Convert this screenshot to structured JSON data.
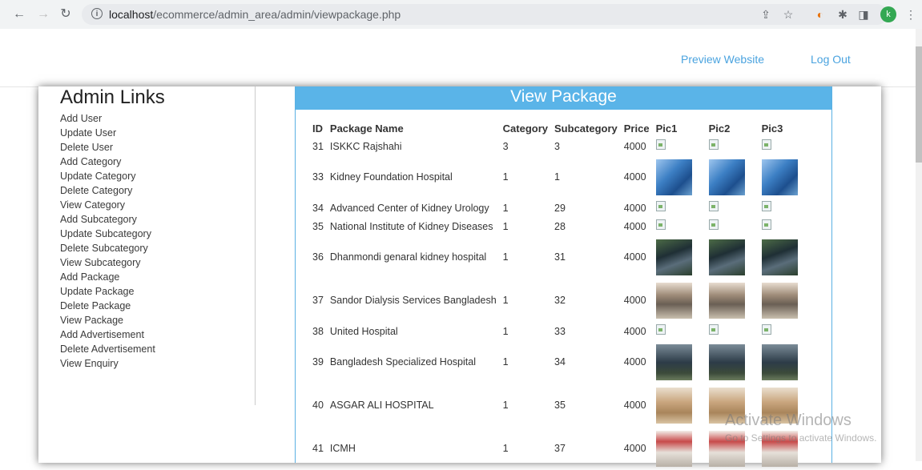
{
  "browser": {
    "url_host": "localhost",
    "url_path": "/ecommerce/admin_area/admin/viewpackage.php",
    "avatar_letter": "k"
  },
  "topnav": {
    "preview_label": "Preview Website",
    "logout_label": "Log Out"
  },
  "sidebar": {
    "title": "Admin Links",
    "items": [
      "Add User",
      "Update User",
      "Delete User",
      "Add Category",
      "Update Category",
      "Delete Category",
      "View Category",
      "Add Subcategory",
      "Update Subcategory",
      "Delete Subcategory",
      "View Subcategory",
      "Add Package",
      "Update Package",
      "Delete Package",
      "View Package",
      "Add Advertisement",
      "Delete Advertisement",
      "View Enquiry"
    ]
  },
  "main": {
    "title": "View Package",
    "columns": [
      "ID",
      "Package Name",
      "Category",
      "Subcategory",
      "Price",
      "Pic1",
      "Pic2",
      "Pic3"
    ],
    "rows": [
      {
        "id": "31",
        "name": "ISKKC Rajshahi",
        "category": "3",
        "subcategory": "3",
        "price": "4000",
        "pic": "broken"
      },
      {
        "id": "33",
        "name": "Kidney Foundation Hospital",
        "category": "1",
        "subcategory": "1",
        "price": "4000",
        "pic": "blue"
      },
      {
        "id": "34",
        "name": "Advanced Center of Kidney Urology",
        "category": "1",
        "subcategory": "29",
        "price": "4000",
        "pic": "broken"
      },
      {
        "id": "35",
        "name": "National Institute of Kidney Diseases",
        "category": "1",
        "subcategory": "28",
        "price": "4000",
        "pic": "broken"
      },
      {
        "id": "36",
        "name": "Dhanmondi genaral kidney hospital",
        "category": "1",
        "subcategory": "31",
        "price": "4000",
        "pic": "green"
      },
      {
        "id": "37",
        "name": "Sandor Dialysis Services Bangladesh",
        "category": "1",
        "subcategory": "32",
        "price": "4000",
        "pic": "lobby"
      },
      {
        "id": "38",
        "name": "United Hospital",
        "category": "1",
        "subcategory": "33",
        "price": "4000",
        "pic": "broken"
      },
      {
        "id": "39",
        "name": "Bangladesh Specialized Hospital",
        "category": "1",
        "subcategory": "34",
        "price": "4000",
        "pic": "tower"
      },
      {
        "id": "40",
        "name": "ASGAR ALI HOSPITAL",
        "category": "1",
        "subcategory": "35",
        "price": "4000",
        "pic": "bldg"
      },
      {
        "id": "41",
        "name": "ICMH",
        "category": "1",
        "subcategory": "37",
        "price": "4000",
        "pic": "red"
      }
    ]
  },
  "watermark": {
    "line1": "Activate Windows",
    "line2": "Go to Settings to activate Windows."
  }
}
